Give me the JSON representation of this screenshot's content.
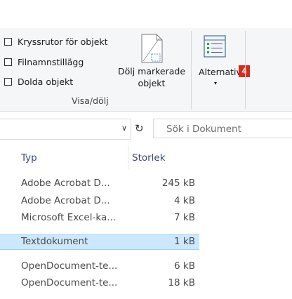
{
  "ribbon": {
    "checkboxes": [
      {
        "label": "Kryssrutor för objekt",
        "checked": false
      },
      {
        "label": "Filnamnstillägg",
        "checked": false
      },
      {
        "label": "Dolda objekt",
        "checked": false
      }
    ],
    "hide_selected_line1": "Dölj markerade",
    "hide_selected_line2": "objekt",
    "options_label": "Alternativ",
    "badge": "4",
    "group_label": "Visa/dölj",
    "dropdown_arrow": "▾"
  },
  "address_bar": {
    "chevron": "∨",
    "refresh": "↻",
    "search_placeholder": "Sök i Dokument"
  },
  "columns": {
    "type": "Typ",
    "size": "Storlek"
  },
  "rows": [
    {
      "type": "Adobe Acrobat D...",
      "size": "245 kB",
      "selected": false
    },
    {
      "type": "Adobe Acrobat D...",
      "size": "4 kB",
      "selected": false
    },
    {
      "type": "Microsoft Excel-ka...",
      "size": "7 kB",
      "selected": false
    },
    {
      "type": "Textdokument",
      "size": "1 kB",
      "selected": true
    },
    {
      "type": "OpenDocument-te...",
      "size": "6 kB",
      "selected": false
    },
    {
      "type": "OpenDocument-te...",
      "size": "18 kB",
      "selected": false
    }
  ],
  "colors": {
    "selected_row": "#cce8ff",
    "badge": "#d52b1e",
    "ribbon_bg": "#f5f6f7"
  }
}
